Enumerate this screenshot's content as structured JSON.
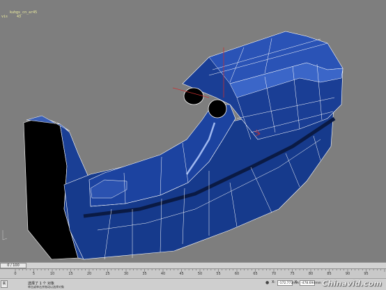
{
  "viewport": {
    "object_name": "kuhgs_cn_ar45",
    "stats": [
      "vis",
      "43"
    ]
  },
  "timeslider": {
    "label": "0 / 100"
  },
  "track": {
    "ticks": [
      0,
      5,
      10,
      15,
      20,
      25,
      30,
      35,
      40,
      45,
      50,
      55,
      60,
      65,
      70,
      75,
      80,
      85,
      90,
      95
    ]
  },
  "statusbar": {
    "icon_label": "实",
    "selection_text": "选择了 1 个 对象",
    "prompt_text": "单击或单击并拖动以选择对象",
    "x_label": "X:",
    "x_value": "-172.773mm",
    "y_label": "Y:",
    "y_value": "-478.694mm"
  },
  "watermark": "Chinavid.com",
  "colors": {
    "viewport_bg": "#7e7e7e",
    "mesh_fill": "#173a8a",
    "mesh_dark": "#0d2256",
    "mesh_highlight": "#6e8fd6",
    "wire": "#ffffff",
    "gizmo": "#c83030"
  }
}
